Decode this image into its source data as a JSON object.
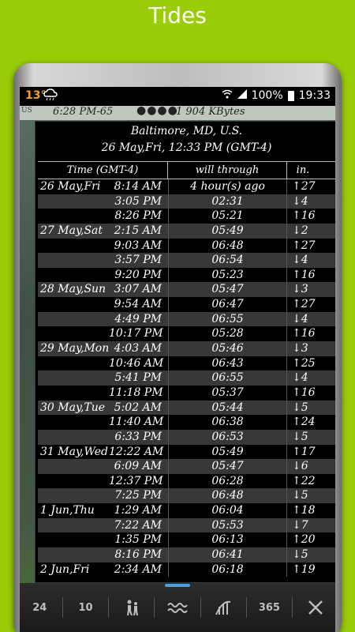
{
  "header": {
    "title": "Tides"
  },
  "status_bar": {
    "temperature": "13°",
    "signal_text": "100%",
    "clock": "19:33",
    "weather_icon": "cloud-rain-icon",
    "icons": [
      "wifi-icon",
      "signal-icon",
      "battery-icon"
    ]
  },
  "info_bar": {
    "region": "US",
    "sun_time": "6:28 PM-65",
    "page_dots": "●●●●",
    "kbytes": "1 904 KBytes"
  },
  "tide": {
    "location": "Baltimore, MD, U.S.",
    "date_line": "26 May,Fri, 12:33 PM (GMT-4)",
    "columns": {
      "time": "Time (GMT-4)",
      "through": "will through",
      "height": "in."
    },
    "rows": [
      {
        "date": "26 May,Fri",
        "time": "8:14 AM",
        "through": "4 hour(s) ago",
        "height": "↑27"
      },
      {
        "date": "",
        "time": "3:05 PM",
        "through": "02:31",
        "height": "↓4"
      },
      {
        "date": "",
        "time": "8:26 PM",
        "through": "05:21",
        "height": "↑16"
      },
      {
        "date": "27 May,Sat",
        "time": "2:15 AM",
        "through": "05:49",
        "height": "↓2"
      },
      {
        "date": "",
        "time": "9:03 AM",
        "through": "06:48",
        "height": "↑27"
      },
      {
        "date": "",
        "time": "3:57 PM",
        "through": "06:54",
        "height": "↓4"
      },
      {
        "date": "",
        "time": "9:20 PM",
        "through": "05:23",
        "height": "↑16"
      },
      {
        "date": "28 May,Sun",
        "time": "3:07 AM",
        "through": "05:47",
        "height": "↓3"
      },
      {
        "date": "",
        "time": "9:54 AM",
        "through": "06:47",
        "height": "↑27"
      },
      {
        "date": "",
        "time": "4:49 PM",
        "through": "06:55",
        "height": "↓4"
      },
      {
        "date": "",
        "time": "10:17 PM",
        "through": "05:28",
        "height": "↑16"
      },
      {
        "date": "29 May,Mon",
        "time": "4:03 AM",
        "through": "05:46",
        "height": "↓3"
      },
      {
        "date": "",
        "time": "10:46 AM",
        "through": "06:43",
        "height": "↑25"
      },
      {
        "date": "",
        "time": "5:41 PM",
        "through": "06:55",
        "height": "↓4"
      },
      {
        "date": "",
        "time": "11:18 PM",
        "through": "05:37",
        "height": "↑16"
      },
      {
        "date": "30 May,Tue",
        "time": "5:02 AM",
        "through": "05:44",
        "height": "↓5"
      },
      {
        "date": "",
        "time": "11:40 AM",
        "through": "06:38",
        "height": "↑24"
      },
      {
        "date": "",
        "time": "6:33 PM",
        "through": "06:53",
        "height": "↓5"
      },
      {
        "date": "31 May,Wed",
        "time": "12:22 AM",
        "through": "05:49",
        "height": "↑17"
      },
      {
        "date": "",
        "time": "6:09 AM",
        "through": "05:47",
        "height": "↓6"
      },
      {
        "date": "",
        "time": "12:37 PM",
        "through": "06:28",
        "height": "↑22"
      },
      {
        "date": "",
        "time": "7:25 PM",
        "through": "06:48",
        "height": "↓5"
      },
      {
        "date": "1 Jun,Thu",
        "time": "1:29 AM",
        "through": "06:04",
        "height": "↑18"
      },
      {
        "date": "",
        "time": "7:22 AM",
        "through": "05:53",
        "height": "↓7"
      },
      {
        "date": "",
        "time": "1:35 PM",
        "through": "06:13",
        "height": "↑20"
      },
      {
        "date": "",
        "time": "8:16 PM",
        "through": "06:41",
        "height": "↓5"
      },
      {
        "date": "2 Jun,Fri",
        "time": "2:34 AM",
        "through": "06:18",
        "height": "↑19"
      }
    ]
  },
  "toolbar": {
    "btn_24": "24",
    "btn_10": "10",
    "btn_365": "365",
    "icons": [
      "hikers-icon",
      "waves-icon",
      "bridge-icon",
      "close-icon"
    ]
  }
}
